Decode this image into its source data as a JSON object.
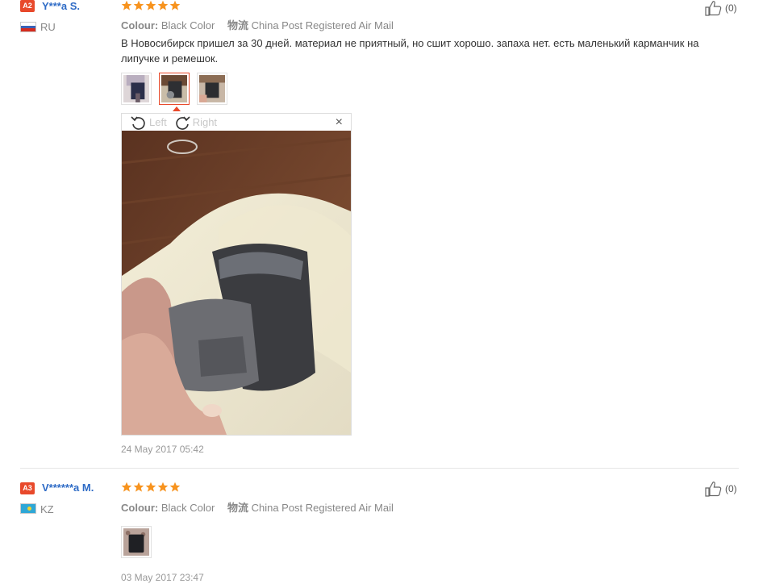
{
  "reviews": [
    {
      "badge": "A2",
      "user": "Y***a S.",
      "country": "RU",
      "colour_label": "Colour:",
      "colour_value": "Black Color",
      "ship_label": "物流",
      "ship_value": "China Post Registered Air Mail",
      "text": "В Новосибирск пришел за 30 дней. материал не приятный, но сшит хорошо. запаха нет. есть маленький карманчик на липучке и ремешок.",
      "date": "24 May 2017 05:42",
      "likes": "(0)",
      "rating": 5,
      "viewer": {
        "left_label": "Left",
        "right_label": "Right",
        "close": "×"
      }
    },
    {
      "badge": "A3",
      "user": "V******a M.",
      "country": "KZ",
      "colour_label": "Colour:",
      "colour_value": "Black Color",
      "ship_label": "物流",
      "ship_value": "China Post Registered Air Mail",
      "date": "03 May 2017 23:47",
      "likes": "(0)",
      "rating": 5
    }
  ],
  "colors": {
    "star": "#f7931e",
    "badge": "#e8492b",
    "username": "#2e6bc6"
  }
}
